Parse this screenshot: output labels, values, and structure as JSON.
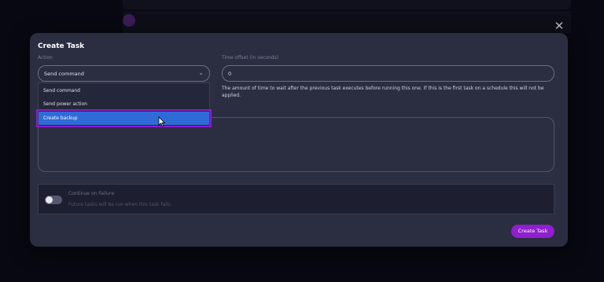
{
  "modal": {
    "title": "Create Task",
    "close_icon": "close-icon",
    "action_label": "Action",
    "action_value": "Send command",
    "action_options": [
      "Send command",
      "Send power action",
      "Create backup"
    ],
    "action_highlighted": "Create backup",
    "time_offset_label": "Time offset (in seconds)",
    "time_offset_value": "0",
    "time_offset_help": "The amount of time to wait after the previous task executes before running this one. If this is the first task on a schedule this will not be applied.",
    "toggle_title": "Continue on Failure",
    "toggle_desc": "Future tasks will be run when this task fails.",
    "toggle_on": false,
    "submit_label": "Create Task"
  },
  "colors": {
    "accent": "#8f1fcf",
    "selected": "#2f6bd6",
    "modal_bg": "#2b2d41"
  }
}
